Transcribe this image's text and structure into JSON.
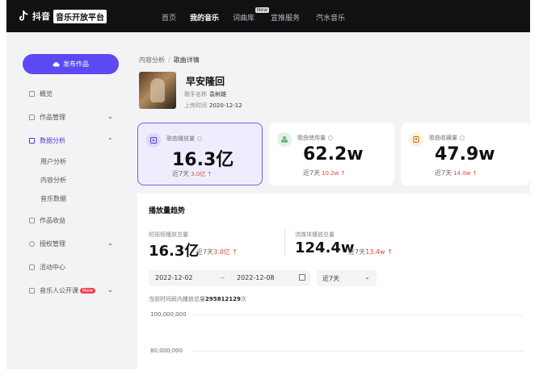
{
  "brand": {
    "name": "抖音",
    "platform": "音乐开放平台"
  },
  "nav": [
    {
      "label": "首页"
    },
    {
      "label": "我的音乐"
    },
    {
      "label": "词曲库",
      "tag": "New"
    },
    {
      "label": "宣推服务"
    },
    {
      "label": "汽水音乐"
    }
  ],
  "sidebar": {
    "publish": "发布作品",
    "items": [
      {
        "label": "概览"
      },
      {
        "label": "作品管理"
      },
      {
        "label": "数据分析"
      },
      {
        "label": "作品收益"
      },
      {
        "label": "授权管理"
      },
      {
        "label": "活动中心"
      },
      {
        "label": "音乐人公开课",
        "badge": "New"
      }
    ],
    "sub": [
      "用户分析",
      "内容分析",
      "音乐数据"
    ]
  },
  "breadcrumb": {
    "parent": "内容分析",
    "sep": "/",
    "current": "歌曲详情"
  },
  "song": {
    "title": "早安隆回",
    "singer_label": "歌手名称",
    "singer": "袁树雄",
    "date_label": "上传时间",
    "date": "2020-12-12"
  },
  "cards": [
    {
      "label": "歌曲播放量",
      "value": "16.3亿",
      "sub_prefix": "近7天",
      "sub_value": "3.0亿",
      "icon": "play-icon"
    },
    {
      "label": "歌曲使用量",
      "value": "62.2w",
      "sub_prefix": "近7天",
      "sub_value": "10.2w",
      "icon": "usage-icon"
    },
    {
      "label": "歌曲收藏量",
      "value": "47.9w",
      "sub_prefix": "近7天",
      "sub_value": "14.0w",
      "icon": "bookmark-icon"
    }
  ],
  "trend": {
    "title": "播放量趋势",
    "m1": {
      "label": "短视频播放总量",
      "value": "16.3亿",
      "sub_prefix": "近7天",
      "sub_value": "3.0亿"
    },
    "m2": {
      "label": "流媒体播放总量",
      "value": "124.4w",
      "sub_prefix": "近7天",
      "sub_value": "13.4w"
    },
    "date_start": "2022-12-02",
    "date_tilde": "~",
    "date_end": "2022-12-08",
    "period": "近7天",
    "total_prefix": "当前时间段内播放总量",
    "total_value": "295812129",
    "total_suffix": "次",
    "y_ticks": [
      "100,000,000",
      "80,000,000"
    ]
  },
  "colors": {
    "accent": "#5b49f3",
    "up": "#e0453a",
    "topbar": "#111114"
  }
}
